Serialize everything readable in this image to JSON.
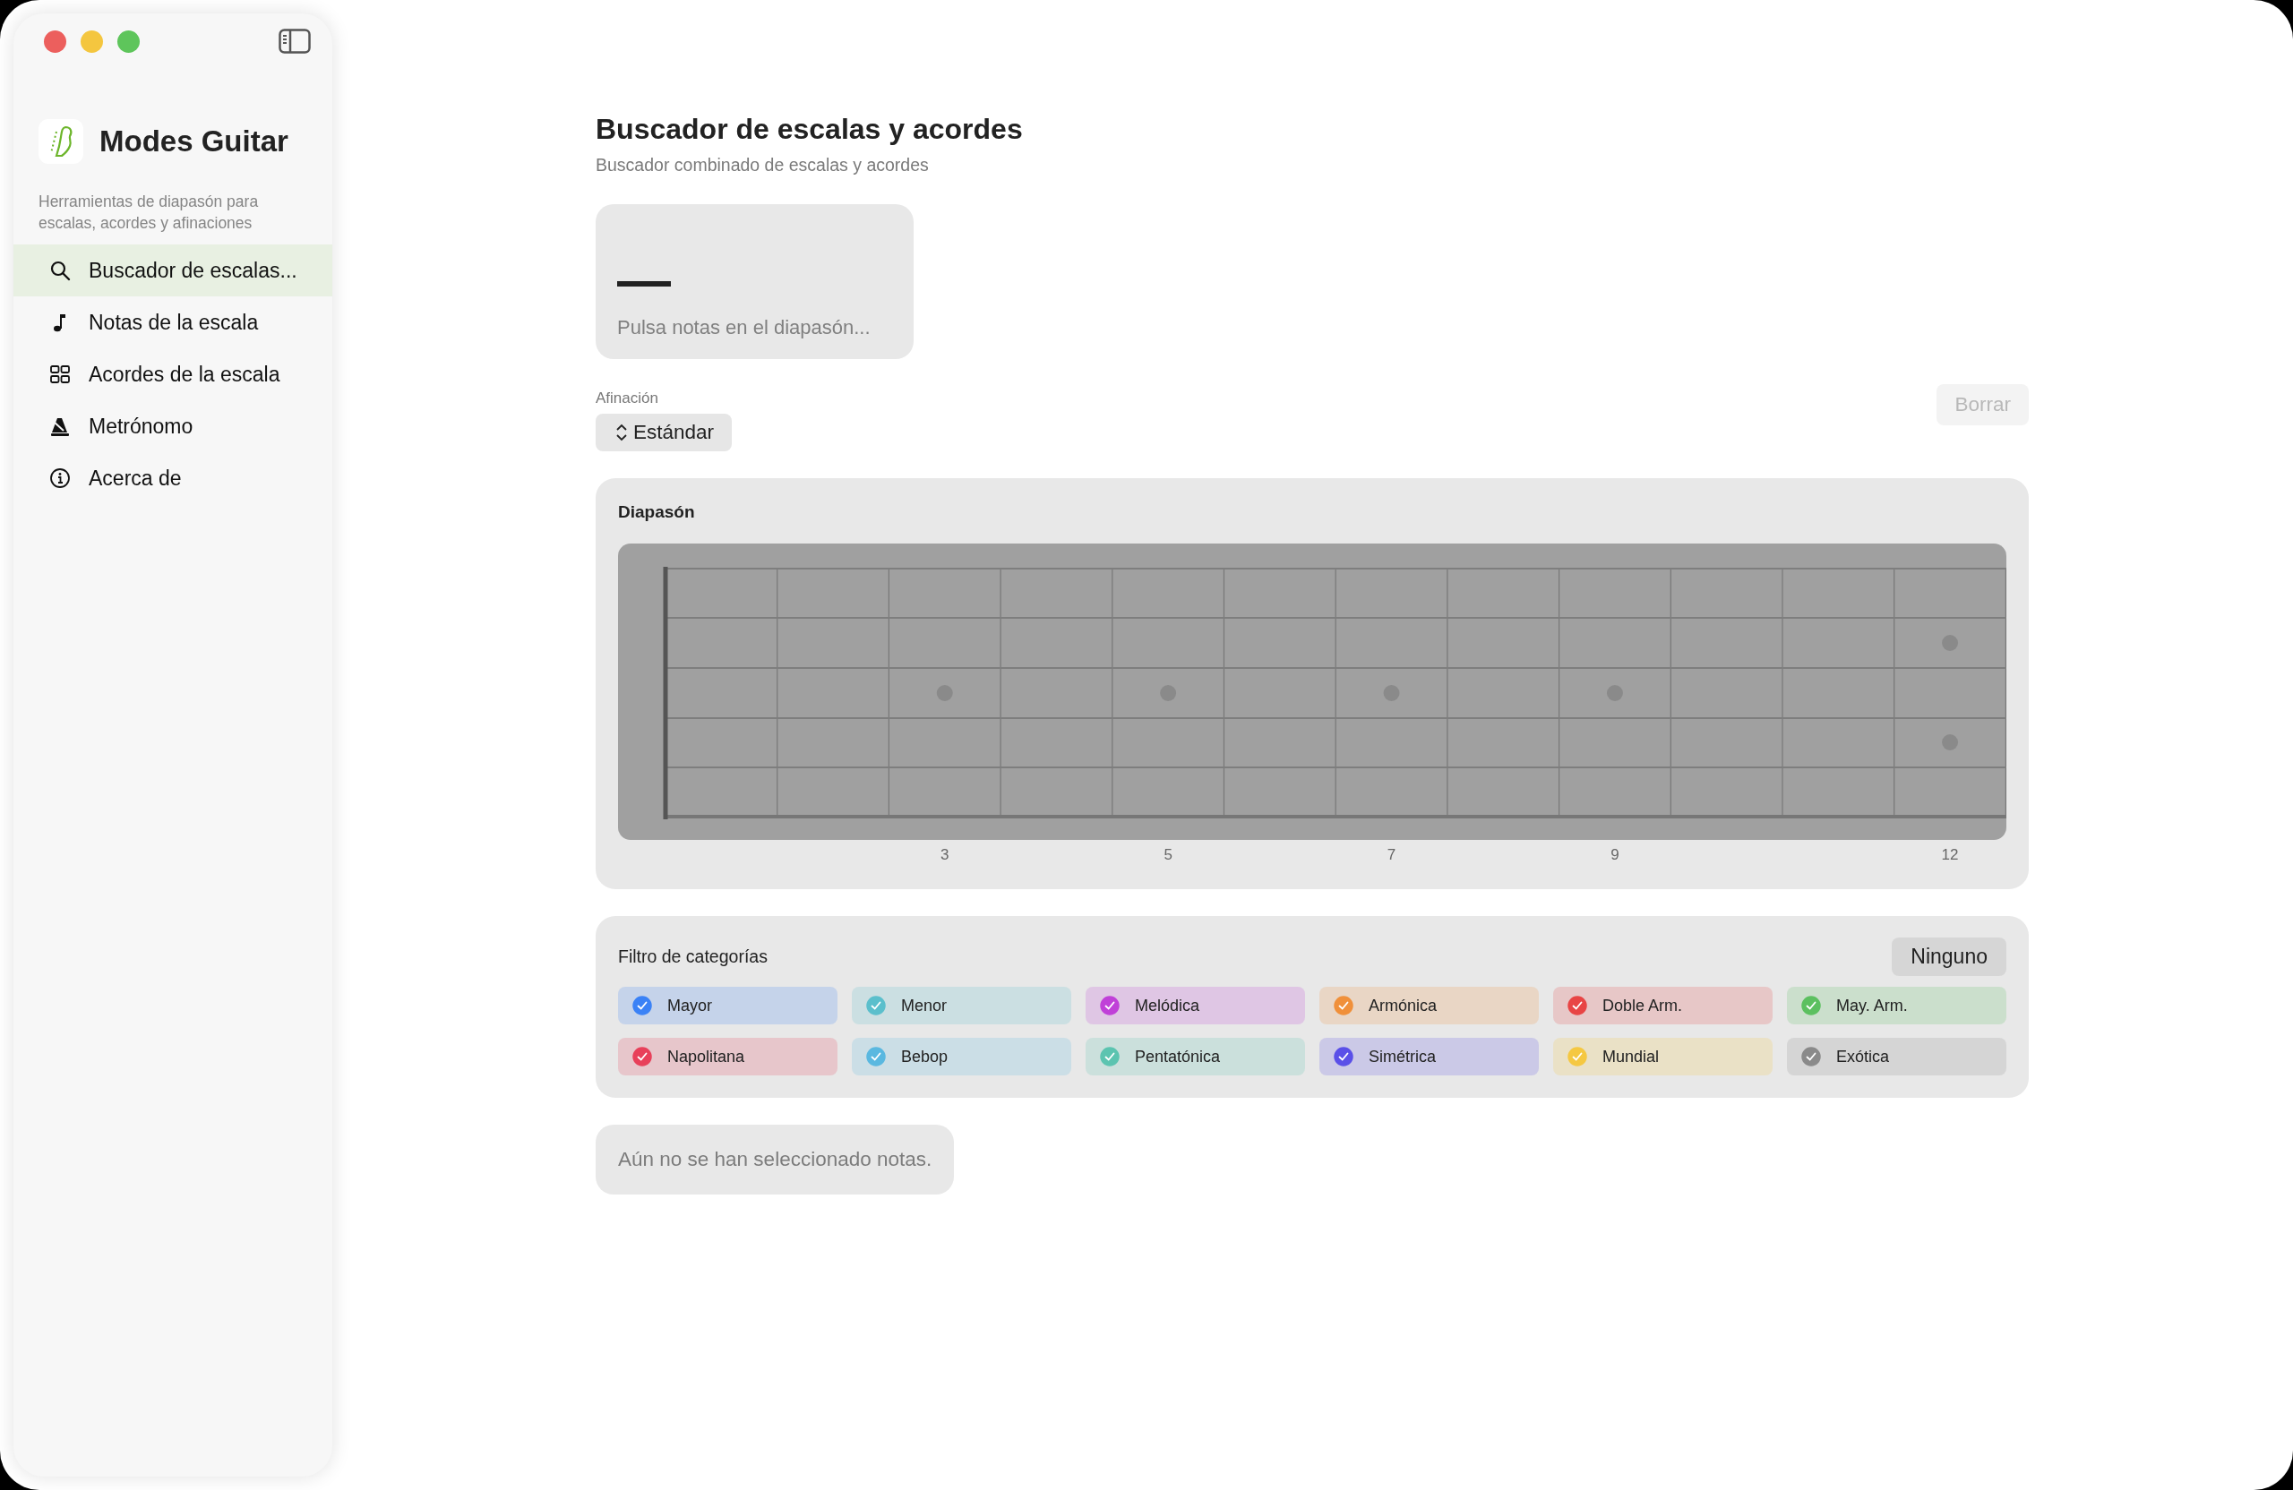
{
  "sidebar": {
    "app_name": "Modes Guitar",
    "description": "Herramientas de diapasón para escalas, acordes y afinaciones",
    "items": [
      {
        "label": "Buscador de escalas...",
        "selected": true
      },
      {
        "label": "Notas de la escala",
        "selected": false
      },
      {
        "label": "Acordes de la escala",
        "selected": false
      },
      {
        "label": "Metrónomo",
        "selected": false
      },
      {
        "label": "Acerca de",
        "selected": false
      }
    ]
  },
  "header": {
    "title": "Buscador de escalas y acordes",
    "subtitle": "Buscador combinado de escalas y acordes"
  },
  "notes_card": {
    "notes": "—",
    "prompt": "Pulsa notas en el diapasón..."
  },
  "tuning": {
    "label": "Afinación",
    "value": "Estándar"
  },
  "clear_button": {
    "label": "Borrar",
    "disabled": true
  },
  "fretboard": {
    "title": "Diapasón",
    "fret_markers": [
      "3",
      "5",
      "7",
      "9",
      "12"
    ]
  },
  "categories": {
    "title": "Filtro de categorías",
    "none_button": "Ninguno",
    "items": [
      {
        "label": "Mayor",
        "color": "#3b82f6",
        "checked": true
      },
      {
        "label": "Menor",
        "color": "#5bbfcc",
        "checked": true
      },
      {
        "label": "Melódica",
        "color": "#c040d8",
        "checked": true
      },
      {
        "label": "Armónica",
        "color": "#f0903a",
        "checked": true
      },
      {
        "label": "Doble Arm.",
        "color": "#e84545",
        "checked": true
      },
      {
        "label": "May. Arm.",
        "color": "#5cc060",
        "checked": true
      },
      {
        "label": "Napolitana",
        "color": "#e8405a",
        "checked": true
      },
      {
        "label": "Bebop",
        "color": "#5ab8e0",
        "checked": true
      },
      {
        "label": "Pentatónica",
        "color": "#5cc4b0",
        "checked": true
      },
      {
        "label": "Simétrica",
        "color": "#5a50e8",
        "checked": true
      },
      {
        "label": "Mundial",
        "color": "#f5c842",
        "checked": true
      },
      {
        "label": "Exótica",
        "color": "#8a8a8a",
        "checked": true
      }
    ]
  },
  "message": "Aún no se han seleccionado notas."
}
